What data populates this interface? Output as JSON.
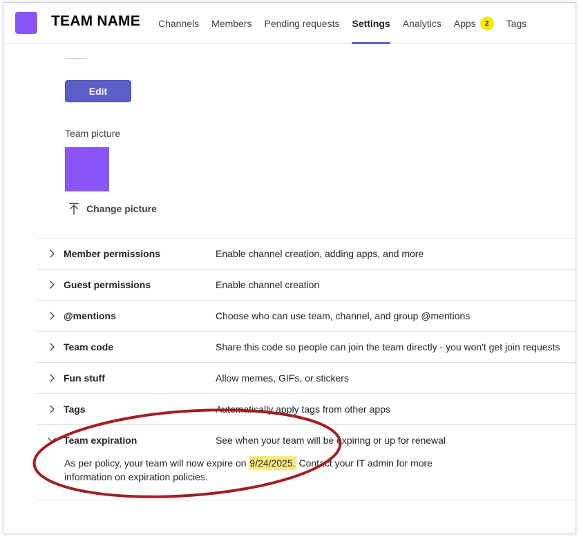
{
  "header": {
    "team_name": "TEAM NAME",
    "tabs": [
      {
        "label": "Channels"
      },
      {
        "label": "Members"
      },
      {
        "label": "Pending requests"
      },
      {
        "label": "Settings",
        "active": true
      },
      {
        "label": "Analytics"
      },
      {
        "label": "Apps",
        "badge": "2"
      },
      {
        "label": "Tags"
      }
    ]
  },
  "profile": {
    "edit_label": "Edit",
    "picture_label": "Team picture",
    "change_picture_label": "Change picture"
  },
  "settings": [
    {
      "title": "Member permissions",
      "desc": "Enable channel creation, adding apps, and more"
    },
    {
      "title": "Guest permissions",
      "desc": "Enable channel creation"
    },
    {
      "title": "@mentions",
      "desc": "Choose who can use team, channel, and group @mentions"
    },
    {
      "title": "Team code",
      "desc": "Share this code so people can join the team directly - you won't get join requests"
    },
    {
      "title": "Fun stuff",
      "desc": "Allow memes, GIFs, or stickers"
    },
    {
      "title": "Tags",
      "desc": "Automatically apply tags from other apps"
    },
    {
      "title": "Team expiration",
      "desc": "See when your team will be expiring or up for renewal",
      "expanded": true
    }
  ],
  "expiration": {
    "text_before": "As per policy, your team will now expire on ",
    "date": "9/24/2025.",
    "text_after": " Contact your IT admin for more information on expiration policies."
  },
  "colors": {
    "brand": "#5b5fc7",
    "avatar": "#8a55f7",
    "badge": "#ffe600",
    "highlight": "#ffe983",
    "annotation": "#a31e22"
  },
  "icons": {
    "collapsed": "chevron-right-icon",
    "expanded": "chevron-down-icon",
    "upload": "arrow-up-icon"
  }
}
